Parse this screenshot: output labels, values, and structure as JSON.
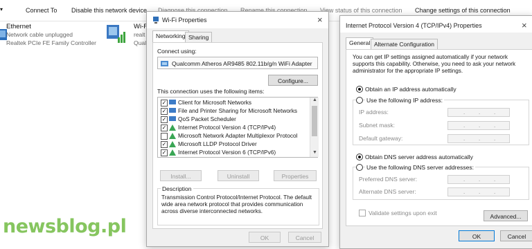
{
  "toolbar": {
    "items": [
      "Connect To",
      "Disable this network device",
      "Diagnose this connection",
      "Rename this connection",
      "View status of this connection",
      "Change settings of this connection"
    ]
  },
  "adapters": {
    "ethernet": {
      "name": "Ethernet",
      "status": "Network cable unplugged",
      "device": "Realtek PCIe FE Family Controller"
    },
    "wifi": {
      "name": "Wi-F",
      "line1": "realt",
      "line2": "Qual"
    }
  },
  "wifi_dialog": {
    "title": "Wi-Fi Properties",
    "tabs": [
      "Networking",
      "Sharing"
    ],
    "connect_using_label": "Connect using:",
    "adapter": "Qualcomm Atheros AR9485 802.11b/g/n WiFi Adapter",
    "configure": "Configure...",
    "items_label": "This connection uses the following items:",
    "items": [
      {
        "text": "Client for Microsoft Networks",
        "checked": true
      },
      {
        "text": "File and Printer Sharing for Microsoft Networks",
        "checked": true
      },
      {
        "text": "QoS Packet Scheduler",
        "checked": true
      },
      {
        "text": "Internet Protocol Version 4 (TCP/IPv4)",
        "checked": true
      },
      {
        "text": "Microsoft Network Adapter Multiplexor Protocol",
        "checked": false
      },
      {
        "text": "Microsoft LLDP Protocol Driver",
        "checked": true
      },
      {
        "text": "Internet Protocol Version 6 (TCP/IPv6)",
        "checked": true
      }
    ],
    "install": "Install...",
    "uninstall": "Uninstall",
    "properties": "Properties",
    "description_label": "Description",
    "description": "Transmission Control Protocol/Internet Protocol. The default wide area network protocol that provides communication across diverse interconnected networks.",
    "ok": "OK",
    "cancel": "Cancel"
  },
  "ipv4_dialog": {
    "title": "Internet Protocol Version 4 (TCP/IPv4) Properties",
    "tabs": [
      "General",
      "Alternate Configuration"
    ],
    "intro": "You can get IP settings assigned automatically if your network supports this capability. Otherwise, you need to ask your network administrator for the appropriate IP settings.",
    "obtain_ip": "Obtain an IP address automatically",
    "use_ip": "Use the following IP address:",
    "ip_address": "IP address:",
    "subnet_mask": "Subnet mask:",
    "default_gateway": "Default gateway:",
    "obtain_dns": "Obtain DNS server address automatically",
    "use_dns": "Use the following DNS server addresses:",
    "preferred_dns": "Preferred DNS server:",
    "alternate_dns": "Alternate DNS server:",
    "validate": "Validate settings upon exit",
    "advanced": "Advanced...",
    "ok": "OK",
    "cancel": "Cancel"
  },
  "watermark": "newsblog.pl"
}
